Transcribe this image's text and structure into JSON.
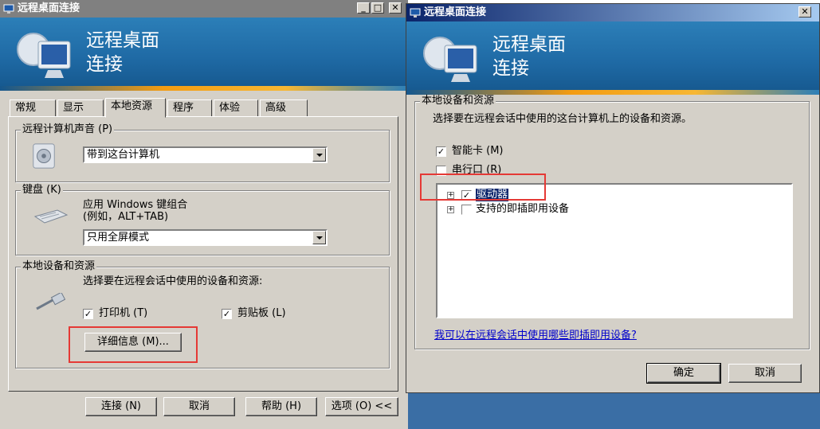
{
  "left_window": {
    "title": "远程桌面连接",
    "banner": {
      "line1": "远程桌面",
      "line2": "连接"
    },
    "tabs": [
      "常规",
      "显示",
      "本地资源",
      "程序",
      "体验",
      "高级"
    ],
    "selected_tab": "本地资源",
    "sound_group": {
      "legend": "远程计算机声音 (P)",
      "select_value": "带到这台计算机"
    },
    "keyboard_group": {
      "legend": "键盘 (K)",
      "desc_line1": "应用 Windows 键组合",
      "desc_line2": "(例如，ALT+TAB)",
      "select_value": "只用全屏模式"
    },
    "local_group": {
      "legend": "本地设备和资源",
      "desc": "选择要在远程会话中使用的设备和资源:",
      "printer_label": "打印机 (T)",
      "clipboard_label": "剪贴板 (L)",
      "details_button": "详细信息 (M)..."
    },
    "footer": {
      "connect": "连接 (N)",
      "cancel": "取消",
      "help": "帮助 (H)",
      "options": "选项 (O) <<"
    }
  },
  "right_window": {
    "title": "远程桌面连接",
    "banner": {
      "line1": "远程桌面",
      "line2": "连接"
    },
    "group_legend": "本地设备和资源",
    "desc": "选择要在远程会话中使用的这台计算机上的设备和资源。",
    "smartcard_label": "智能卡 (M)",
    "serial_label": "串行口 (R)",
    "tree": [
      {
        "label": "驱动器",
        "checked": true,
        "selected": true
      },
      {
        "label": "支持的即插即用设备",
        "checked": false,
        "selected": false
      }
    ],
    "link": "我可以在远程会话中使用哪些即插即用设备?",
    "ok": "确定",
    "cancel": "取消"
  },
  "colors": {
    "highlight_box": "#e53935",
    "desktop": "#3a6ea5"
  }
}
